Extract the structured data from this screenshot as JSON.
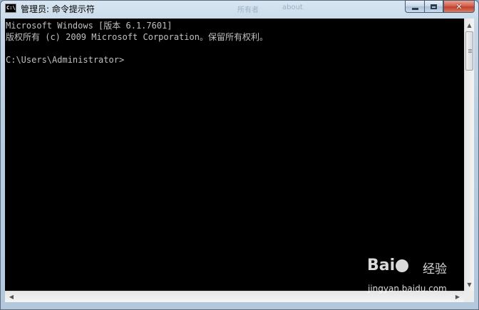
{
  "window": {
    "title": "管理员: 命令提示符",
    "icon_text": "C:\\",
    "icon_name": "cmd-icon"
  },
  "background_titles": [
    "所有者",
    "about"
  ],
  "caption_buttons": {
    "close_glyph": "✕"
  },
  "console": {
    "lines": [
      "Microsoft Windows [版本 6.1.7601]",
      "版权所有 (c) 2009 Microsoft Corporation。保留所有权利。",
      "",
      "C:\\Users\\Administrator>"
    ],
    "background_color": "#000000",
    "text_color": "#c0c0c0"
  },
  "scrollbar": {
    "up_arrow": "▲",
    "down_arrow": "▼",
    "left_arrow": "◀",
    "right_arrow": "▶"
  },
  "watermark": {
    "brand_left": "Bai",
    "brand_right": "",
    "brand_cn": "经验",
    "url": "jingyan.baidu.com"
  }
}
